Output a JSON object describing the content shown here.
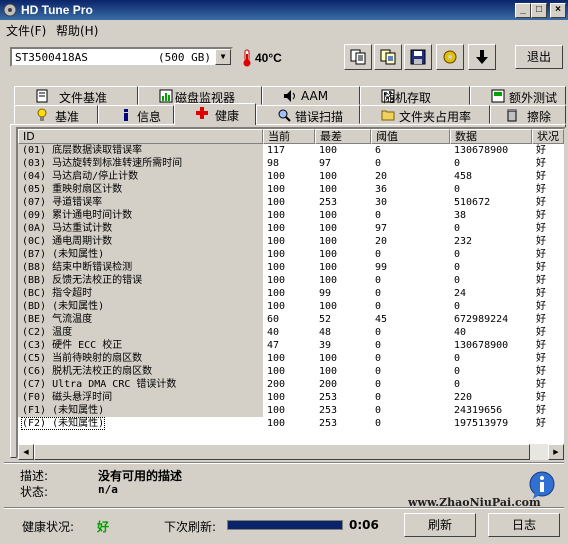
{
  "window": {
    "title": "HD Tune Pro",
    "buttons": {
      "minimize": "_",
      "maximize": "□",
      "close": "×"
    }
  },
  "menu": {
    "file": "文件(F)",
    "help": "帮助(H)"
  },
  "toolbar": {
    "drive_name": "ST3500418AS",
    "drive_size": "(500 GB)",
    "temperature": "40°C",
    "exit_label": "退出",
    "icons": [
      "copy-text-icon",
      "copy-screen-icon",
      "save-icon",
      "options-icon",
      "down-arrow-icon"
    ]
  },
  "tabs_row1": [
    {
      "label": "文件基准",
      "icon": "file-benchmark-icon"
    },
    {
      "label": "磁盘监视器",
      "icon": "disk-monitor-icon"
    },
    {
      "label": "AAM",
      "icon": "speaker-icon"
    },
    {
      "label": "随机存取",
      "icon": "random-access-icon"
    },
    {
      "label": "额外测试",
      "icon": "extra-tests-icon"
    }
  ],
  "tabs_row2": [
    {
      "label": "基准",
      "icon": "benchmark-icon"
    },
    {
      "label": "信息",
      "icon": "info-icon"
    },
    {
      "label": "健康",
      "icon": "health-icon"
    },
    {
      "label": "错误扫描",
      "icon": "error-scan-icon"
    },
    {
      "label": "文件夹占用率",
      "icon": "folder-usage-icon"
    },
    {
      "label": "擦除",
      "icon": "erase-icon"
    }
  ],
  "active_tab": "健康",
  "table": {
    "headers": [
      "ID",
      "当前",
      "最差",
      "阈值",
      "数据",
      "状况"
    ],
    "rows": [
      {
        "id": "(01) 底层数据读取错误率",
        "cur": "117",
        "worst": "100",
        "thr": "6",
        "data": "130678900",
        "status": "好"
      },
      {
        "id": "(03) 马达旋转到标准转速所需时间",
        "cur": "98",
        "worst": "97",
        "thr": "0",
        "data": "0",
        "status": "好"
      },
      {
        "id": "(04) 马达启动/停止计数",
        "cur": "100",
        "worst": "100",
        "thr": "20",
        "data": "458",
        "status": "好"
      },
      {
        "id": "(05) 重映射扇区计数",
        "cur": "100",
        "worst": "100",
        "thr": "36",
        "data": "0",
        "status": "好"
      },
      {
        "id": "(07) 寻道错误率",
        "cur": "100",
        "worst": "253",
        "thr": "30",
        "data": "510672",
        "status": "好"
      },
      {
        "id": "(09) 累计通电时间计数",
        "cur": "100",
        "worst": "100",
        "thr": "0",
        "data": "38",
        "status": "好"
      },
      {
        "id": "(0A) 马达重试计数",
        "cur": "100",
        "worst": "100",
        "thr": "97",
        "data": "0",
        "status": "好"
      },
      {
        "id": "(0C) 通电周期计数",
        "cur": "100",
        "worst": "100",
        "thr": "20",
        "data": "232",
        "status": "好"
      },
      {
        "id": "(B7) (未知属性)",
        "cur": "100",
        "worst": "100",
        "thr": "0",
        "data": "0",
        "status": "好"
      },
      {
        "id": "(B8) 结束中断错误检测",
        "cur": "100",
        "worst": "100",
        "thr": "99",
        "data": "0",
        "status": "好"
      },
      {
        "id": "(BB) 反馈无法校正的错误",
        "cur": "100",
        "worst": "100",
        "thr": "0",
        "data": "0",
        "status": "好"
      },
      {
        "id": "(BC) 指令超时",
        "cur": "100",
        "worst": "99",
        "thr": "0",
        "data": "24",
        "status": "好"
      },
      {
        "id": "(BD) (未知属性)",
        "cur": "100",
        "worst": "100",
        "thr": "0",
        "data": "0",
        "status": "好"
      },
      {
        "id": "(BE) 气流温度",
        "cur": "60",
        "worst": "52",
        "thr": "45",
        "data": "672989224",
        "status": "好"
      },
      {
        "id": "(C2) 温度",
        "cur": "40",
        "worst": "48",
        "thr": "0",
        "data": "40",
        "status": "好"
      },
      {
        "id": "(C3) 硬件 ECC 校正",
        "cur": "47",
        "worst": "39",
        "thr": "0",
        "data": "130678900",
        "status": "好"
      },
      {
        "id": "(C5) 当前待映射的扇区数",
        "cur": "100",
        "worst": "100",
        "thr": "0",
        "data": "0",
        "status": "好"
      },
      {
        "id": "(C6) 脱机无法校正的扇区数",
        "cur": "100",
        "worst": "100",
        "thr": "0",
        "data": "0",
        "status": "好"
      },
      {
        "id": "(C7) Ultra DMA CRC 错误计数",
        "cur": "200",
        "worst": "200",
        "thr": "0",
        "data": "0",
        "status": "好"
      },
      {
        "id": "(F0) 磁头悬浮时间",
        "cur": "100",
        "worst": "253",
        "thr": "0",
        "data": "220",
        "status": "好"
      },
      {
        "id": "(F1) (未知属性)",
        "cur": "100",
        "worst": "253",
        "thr": "0",
        "data": "24319656",
        "status": "好"
      },
      {
        "id": "(F2) (未知属性)",
        "cur": "100",
        "worst": "253",
        "thr": "0",
        "data": "197513979",
        "status": "好"
      }
    ]
  },
  "details": {
    "desc_label": "描述:",
    "desc_value": "没有可用的描述",
    "state_label": "状态:",
    "state_value": "n/a",
    "watermark": "www.ZhaoNiuPai.com"
  },
  "footer": {
    "health_label": "健康状况:",
    "health_value": "好",
    "health_color": "#00a000",
    "next_refresh_label": "下次刷新:",
    "refresh_progress": 1.0,
    "timer": "0:06",
    "refresh_button": "刷新",
    "log_button": "日志"
  }
}
